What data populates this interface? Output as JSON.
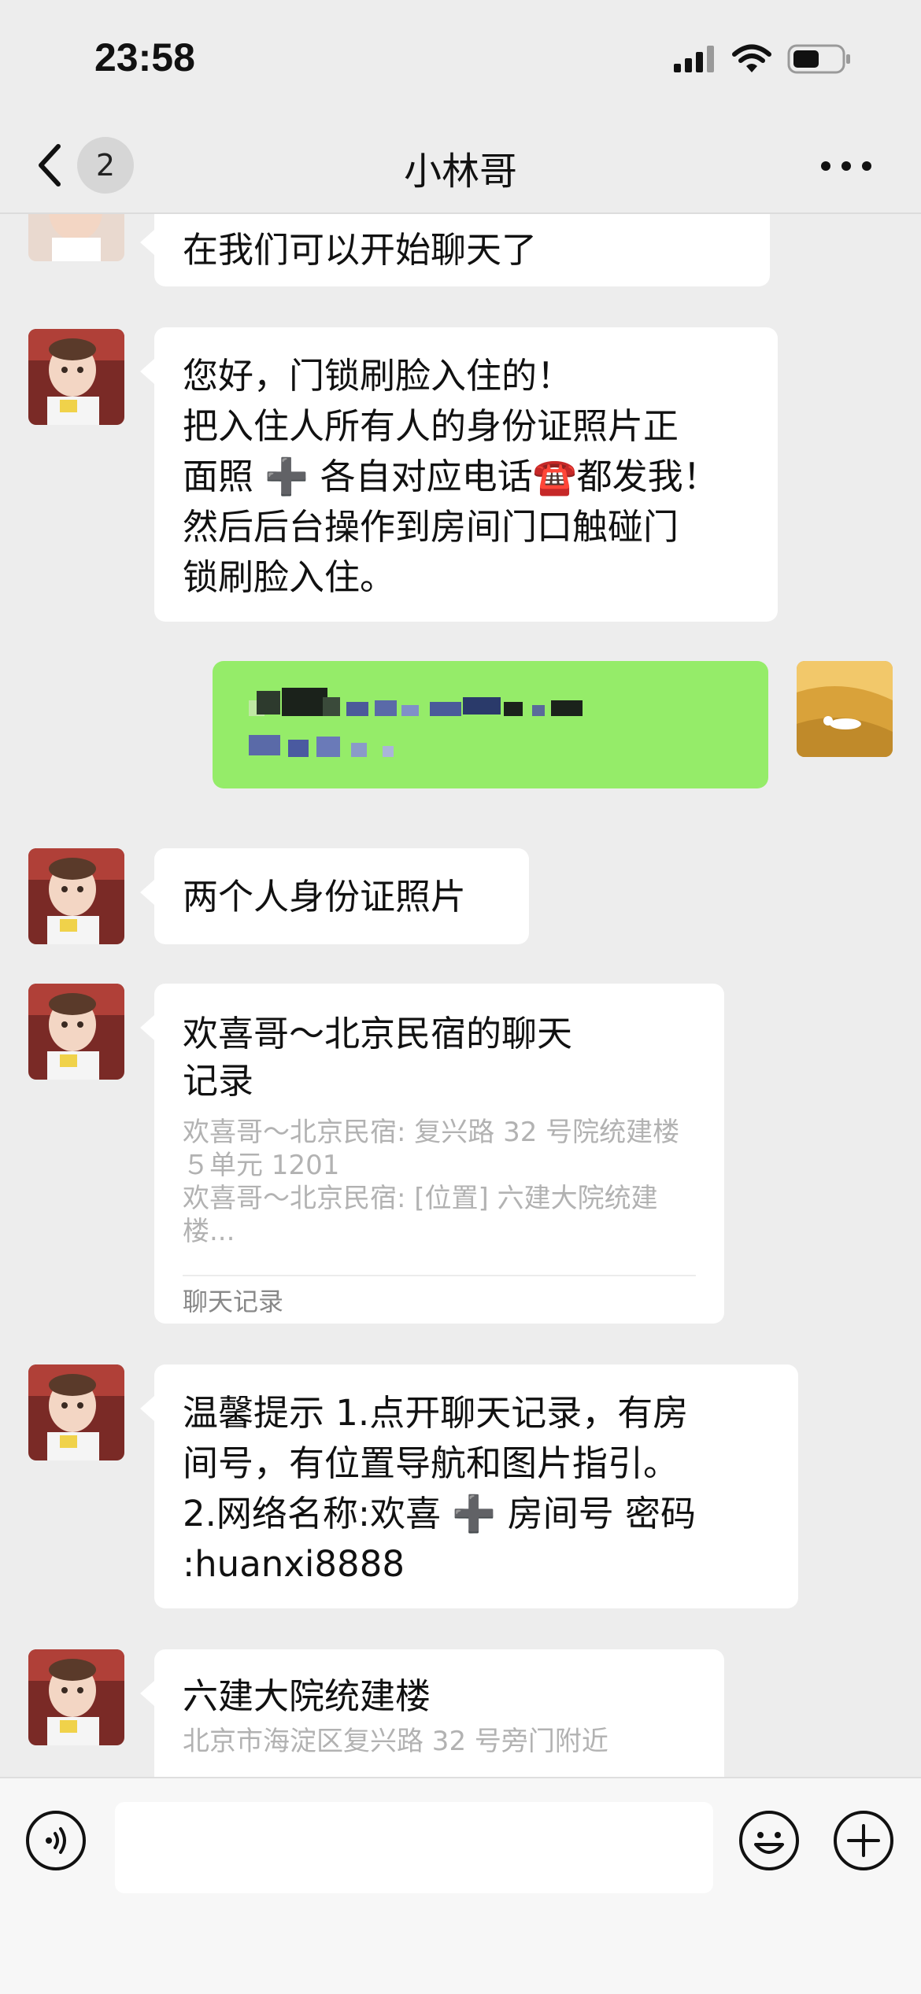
{
  "status": {
    "time": "23:58"
  },
  "nav": {
    "back_badge": "2",
    "title": "小林哥"
  },
  "messages": {
    "m0": "在我们可以开始聊天了",
    "m1": [
      "您好，门锁刷脸入住的！",
      "把入住人所有人的身份证照片正",
      "面照 ➕ 各自对应电话☎️都发我！",
      "然后后台操作到房间门口触碰门",
      "锁刷脸入住。"
    ],
    "m3": "两个人身份证照片",
    "card": {
      "title": [
        "欢喜哥～北京民宿的聊天",
        "记录"
      ],
      "line1": "欢喜哥～北京民宿: 复兴路 32 号院统建楼",
      "line1b": "５单元 1201",
      "line2": "欢喜哥～北京民宿: [位置] 六建大院统建",
      "line2b": "楼...",
      "footer": "聊天记录"
    },
    "tip": [
      "温馨提示   1.点开聊天记录，有房",
      "间号，有位置导航和图片指引。",
      "2.网络名称:欢喜 ➕ 房间号   密码",
      ":huanxi8888"
    ],
    "location": {
      "name": "六建大院统建楼",
      "address": "北京市海淀区复兴路 32 号旁门附近"
    }
  },
  "colors": {
    "sent_bubble": "#95ec69",
    "background": "#ededed"
  },
  "icons": [
    "signal-icon",
    "wifi-icon",
    "battery-icon",
    "back-chevron-icon",
    "more-icon",
    "voice-icon",
    "emoji-icon",
    "plus-icon"
  ]
}
